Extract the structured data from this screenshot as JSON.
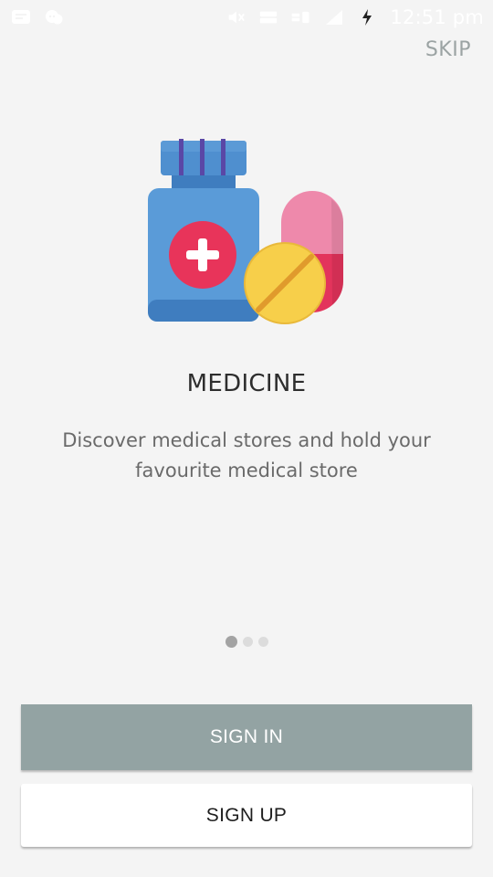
{
  "status_bar": {
    "time": "12:51 pm",
    "icons": [
      "message-icon",
      "chat-bubble-icon",
      "mute-icon",
      "volte-icon",
      "lte-icon",
      "signal-icon",
      "charging-icon"
    ],
    "volte_label": "Vo)\nLTE",
    "lte_label": "LTE"
  },
  "header": {
    "skip_label": "SKIP"
  },
  "slide": {
    "illustration_icon": "medicine-bottle-and-pills-icon",
    "title": "MEDICINE",
    "description": "Discover medical stores and hold your favourite medical store"
  },
  "pager": {
    "count": 3,
    "active_index": 0
  },
  "actions": {
    "sign_in_label": "SIGN IN",
    "sign_up_label": "SIGN UP"
  },
  "colors": {
    "background": "#f4f4f4",
    "sign_in_bg": "#93a3a3",
    "sign_up_bg": "#ffffff",
    "skip_text": "#9ba3a3"
  }
}
